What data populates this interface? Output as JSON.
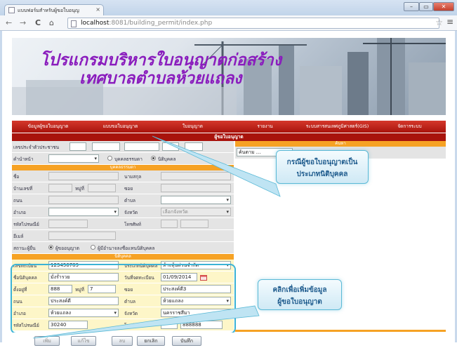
{
  "browser": {
    "tab_title": "แบบฟอร์มสำหรับผู้ขอใบอนุญ",
    "tab_close": "×",
    "url_host": "localhost",
    "url_rest": ":8081/building_permit/index.php",
    "back": "←",
    "forward": "→",
    "reload": "C",
    "home": "⌂",
    "star": "☆",
    "menu": "≡",
    "win_min": "–",
    "win_max": "▭",
    "win_close": "✕"
  },
  "banner": {
    "title_line1": "โปรแกรมบริหารใบอนุญาตก่อสร้าง",
    "title_line2": "เทศบาลตำบลห้วยแถลง"
  },
  "menu": [
    "ข้อมูลผู้ขอใบอนุญาต",
    "แบบขอใบอนุญาต",
    "ใบอนุญาต",
    "รายงาน",
    "ระบบสารสนเทศภูมิศาสตร์(GIS)",
    "จัดการระบบ"
  ],
  "section_title": "ผู้ขอใบอนุญาต",
  "form": {
    "id_label": "เลขประจำตัวประชาชน",
    "prefix_label": "คำนำหน้า",
    "radio_person": "บุคคลธรรมดา",
    "radio_juristic": "นิติบุคคล",
    "person_header": "บุคคลธรรมดา",
    "name_label": "ชื่อ",
    "surname_label": "นามสกุล",
    "house_label": "บ้านเลขที่",
    "moo_label": "หมู่ที่",
    "soi_label": "ซอย",
    "road_label": "ถนน",
    "tambon_label": "ตำบล",
    "amphoe_label": "อำเภอ",
    "province_label": "จังหวัด",
    "province_placeholder": "เลือกจังหวัด",
    "postcode_label": "รหัสไปรษณีย์",
    "phone_label": "โทรศัพท์",
    "email_label": "อีเมล์",
    "status_label": "สถานะผู้ยื่น",
    "status_opt1": "ผู้ขออนุญาต",
    "status_opt2": "ผู้มีอำนาจลงชื่อแทนนิติบุคคล"
  },
  "juristic": {
    "header": "นิติบุคคล",
    "reg_label": "เลขทะเบียน",
    "reg_value": "123456789",
    "type_label": "ประเภทนิติบุคคล",
    "type_value": "ห้างหุ้นส่วนจำกัด",
    "name_label": "ชื่อนิติบุคคล",
    "name_value": "มั่งร่ำรวย",
    "regdate_label": "วันที่จดทะเบียน",
    "regdate_value": "01/09/2014",
    "house_label": "ตั้งอยู่ที่",
    "house_value": "888",
    "moo_label": "หมู่ที่",
    "moo_value": "7",
    "soi_label": "ซอย",
    "soi_value": "ประสงค์ดี3",
    "road_label": "ถนน",
    "road_value": "ประสงค์ดี",
    "tambon_label": "ตำบล",
    "tambon_value": "ห้วยแถลง",
    "amphoe_label": "อำเภอ",
    "amphoe_value": "ห้วยแถลง",
    "province_label": "จังหวัด",
    "province_value": "นครราชสีมา",
    "postcode_label": "รหัสไปรษณีย์",
    "postcode_value": "30240",
    "phone_label": "โทรศัพท์",
    "phone_value": "888888"
  },
  "search": {
    "header": "ค้นหา",
    "select_value": "ค้นตาม ..."
  },
  "buttons": {
    "add": "เพิ่ม",
    "edit": "แก้ไข",
    "delete": "ลบ",
    "cancel": "ยกเลิก",
    "save": "บันทึก"
  },
  "callouts": {
    "juristic_note_line1": "กรณีผู้ขอใบอนุญาตเป็น",
    "juristic_note_line2": "ประเภทนิติบุคคล",
    "add_note_line1": "คลิกเพื่อเพิ่มข้อมูล",
    "add_note_line2": "ผู้ขอใบอนุญาต"
  }
}
